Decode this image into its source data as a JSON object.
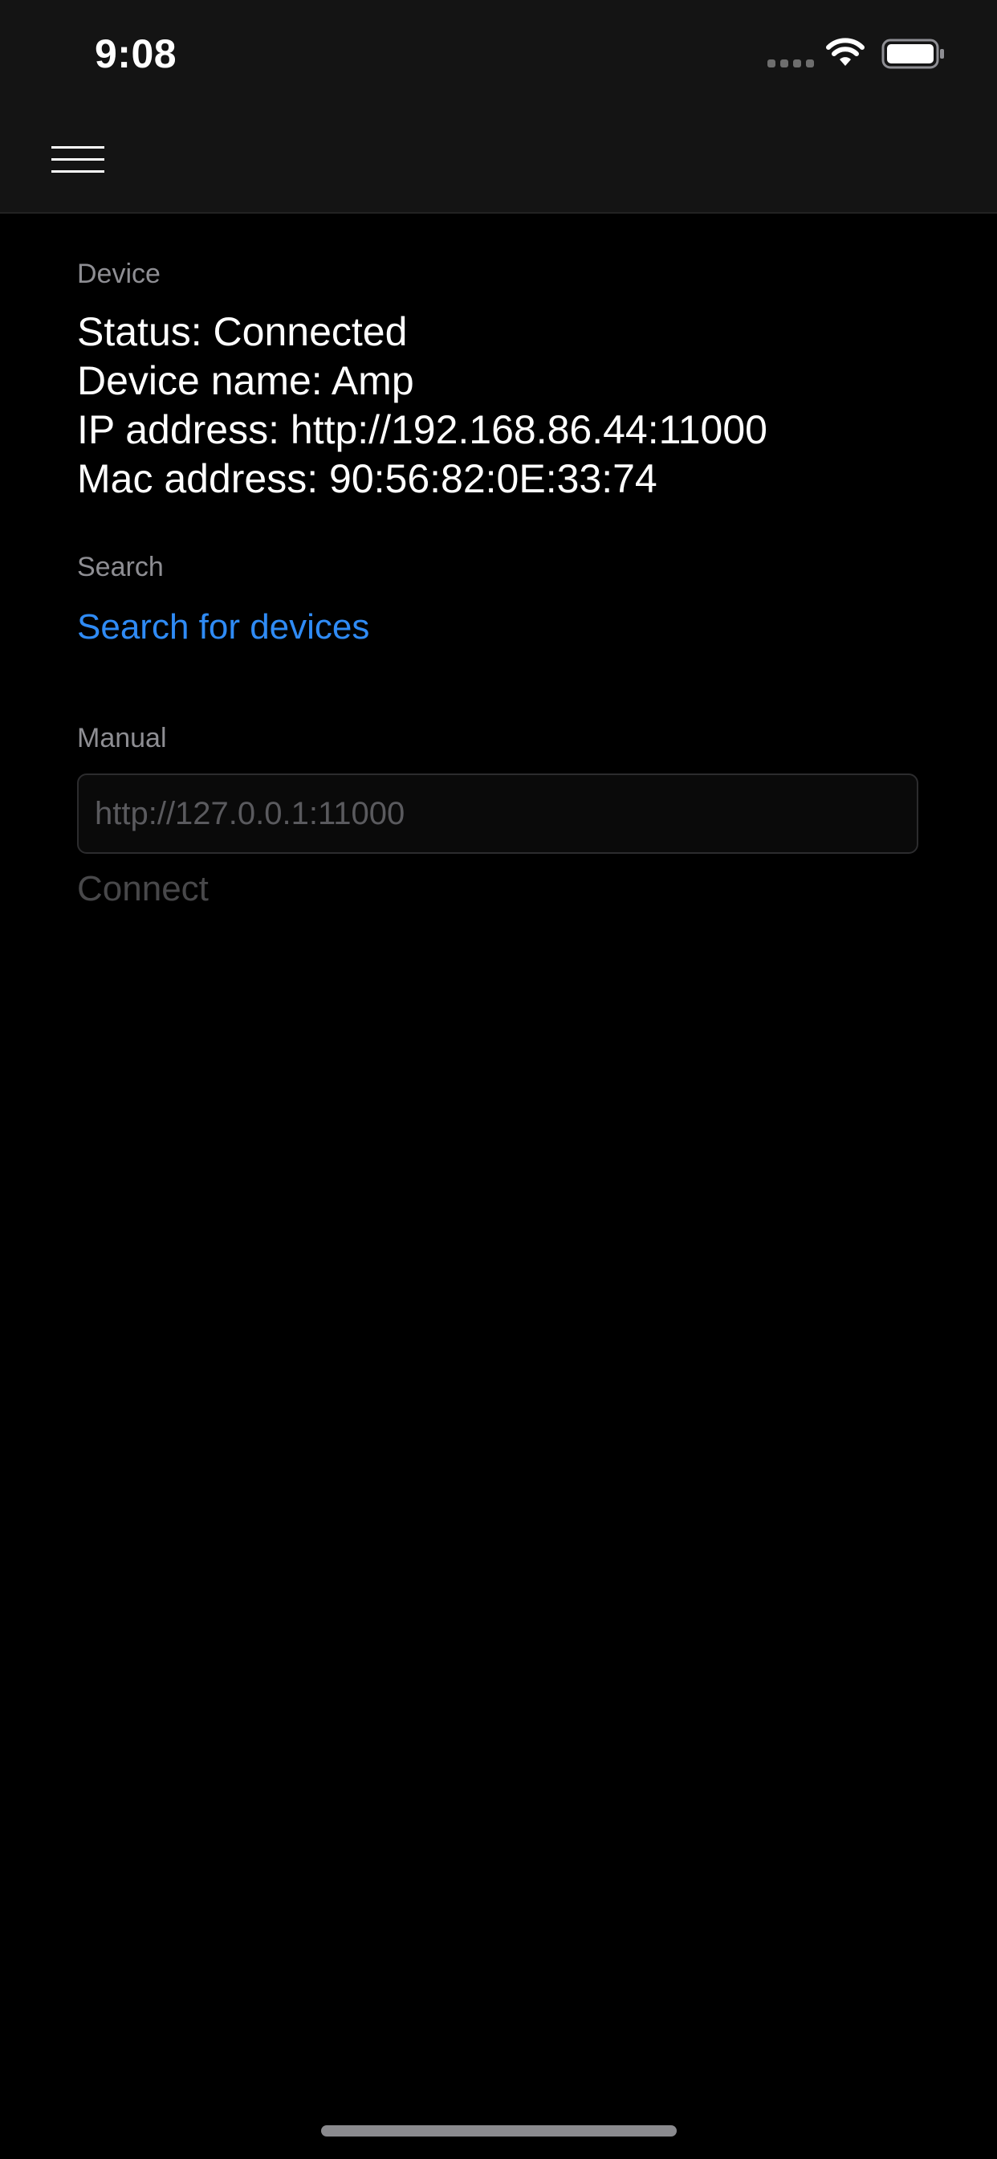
{
  "status_bar": {
    "time": "9:08",
    "signal_icon": "cellular-signal-icon",
    "wifi_icon": "wifi-icon",
    "battery_icon": "battery-icon",
    "battery_level": 1.0
  },
  "nav": {
    "menu_icon": "hamburger-menu-icon"
  },
  "device_section": {
    "label": "Device",
    "status": "Status: Connected",
    "device_name": "Device name: Amp",
    "ip_address": "IP address: http://192.168.86.44:11000",
    "mac_address": "Mac address: 90:56:82:0E:33:74"
  },
  "search_section": {
    "label": "Search",
    "action_label": "Search for devices"
  },
  "manual_section": {
    "label": "Manual",
    "input_value": "",
    "input_placeholder": "http://127.0.0.1:11000",
    "connect_label": "Connect"
  },
  "colors": {
    "background": "#000000",
    "top_bar": "#141414",
    "section_label": "#8e8e93",
    "link": "#2f8bf5",
    "disabled": "#48484a"
  }
}
